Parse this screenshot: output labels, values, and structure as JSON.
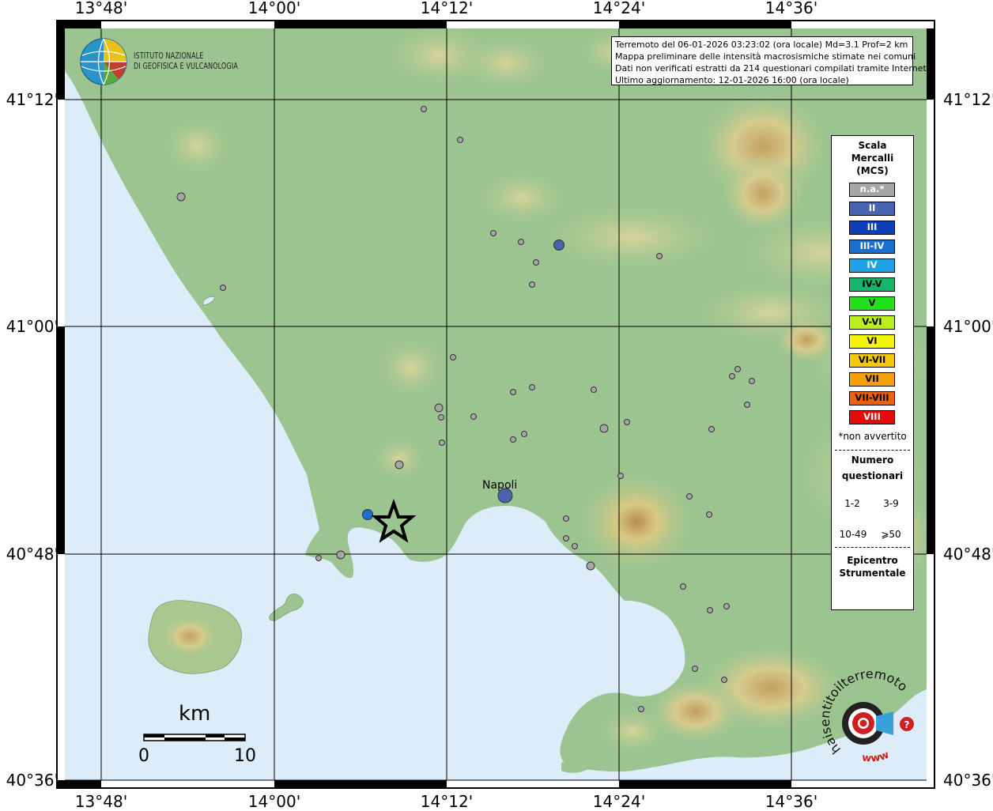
{
  "coords": {
    "top": [
      "13°48'",
      "14°00'",
      "14°12'",
      "14°24'",
      "14°36'"
    ],
    "bottom": [
      "13°48'",
      "14°00'",
      "14°12'",
      "14°24'",
      "14°36'"
    ],
    "left": [
      "41°12'",
      "41°00'",
      "40°48'",
      "40°36'"
    ],
    "right": [
      "41°12'",
      "41°00'",
      "40°48'",
      "40°36'"
    ]
  },
  "info": {
    "line1": "Terremoto del 06-01-2026 03:23:02 (ora locale) Md=3.1 Prof=2 km",
    "line2": "Mappa preliminare delle intensità macrosismiche stimate nei comuni",
    "line3": "Dati non verificati estratti da 214 questionari compilati tramite Internet.",
    "line4": "Ultimo aggiornamento: 12-01-2026 16:00 (ora locale)"
  },
  "ingv": {
    "line1": "ISTITUTO NAZIONALE",
    "line2": "DI GEOFISICA E VULCANOLOGIA"
  },
  "legend": {
    "title1": "Scala",
    "title2": "Mercalli",
    "title3": "(MCS)",
    "classes": [
      {
        "label": "n.a.*",
        "color": "#a6a6a6",
        "text": "#ffffff"
      },
      {
        "label": "II",
        "color": "#4a63b0",
        "text": "#ffffff"
      },
      {
        "label": "III",
        "color": "#0d3fb8",
        "text": "#ffffff"
      },
      {
        "label": "III-IV",
        "color": "#1a6fd0",
        "text": "#ffffff"
      },
      {
        "label": "IV",
        "color": "#1ea3e6",
        "text": "#ffffff"
      },
      {
        "label": "IV-V",
        "color": "#16b56a",
        "text": "#000000"
      },
      {
        "label": "V",
        "color": "#22e01c",
        "text": "#000000"
      },
      {
        "label": "V-VI",
        "color": "#b8ef1c",
        "text": "#000000"
      },
      {
        "label": "VI",
        "color": "#f5f50a",
        "text": "#000000"
      },
      {
        "label": "VI-VII",
        "color": "#f5c80a",
        "text": "#000000"
      },
      {
        "label": "VII",
        "color": "#f5a00a",
        "text": "#000000"
      },
      {
        "label": "VII-VIII",
        "color": "#f0600a",
        "text": "#000000"
      },
      {
        "label": "VIII",
        "color": "#e80a0a",
        "text": "#ffffff"
      }
    ],
    "not_felt": "*non avvertito",
    "count_title1": "Numero",
    "count_title2": "questionari",
    "counts": [
      "1-2",
      "3-9",
      "10-49",
      "⩾50"
    ],
    "epi_title1": "Epicentro",
    "epi_title2": "Strumentale"
  },
  "scalebar": {
    "title": "km",
    "start": "0",
    "end": "10"
  },
  "places": {
    "napoli": "Napoli"
  },
  "hai_logo": {
    "text": "haisentitoilterremoto.it",
    "url": "www"
  },
  "colors": {
    "sea": "#dcecf8",
    "land": "#96c08c",
    "hills": "#c8c48a",
    "peaks": "#c09a5c"
  }
}
